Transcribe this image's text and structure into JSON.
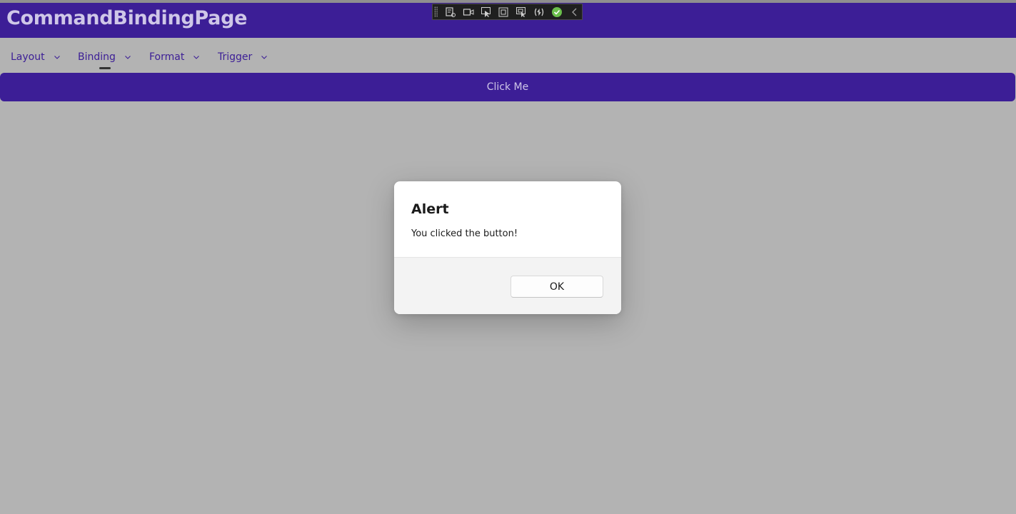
{
  "header": {
    "title": "CommandBindingPage",
    "color": "#3c1e96"
  },
  "debug_toolbar": {
    "icons": [
      "live-visual-tree-icon",
      "record-icon",
      "select-element-icon",
      "display-layout-adorners-icon",
      "track-focus-icon",
      "hot-reload-icon",
      "binding-success-icon",
      "collapse-chevron-icon"
    ]
  },
  "menu": {
    "items": [
      {
        "label": "Layout"
      },
      {
        "label": "Binding"
      },
      {
        "label": "Format"
      },
      {
        "label": "Trigger"
      }
    ],
    "selected": "Binding"
  },
  "main": {
    "button_label": "Click Me"
  },
  "dialog": {
    "title": "Alert",
    "message": "You clicked the button!",
    "ok_label": "OK"
  }
}
